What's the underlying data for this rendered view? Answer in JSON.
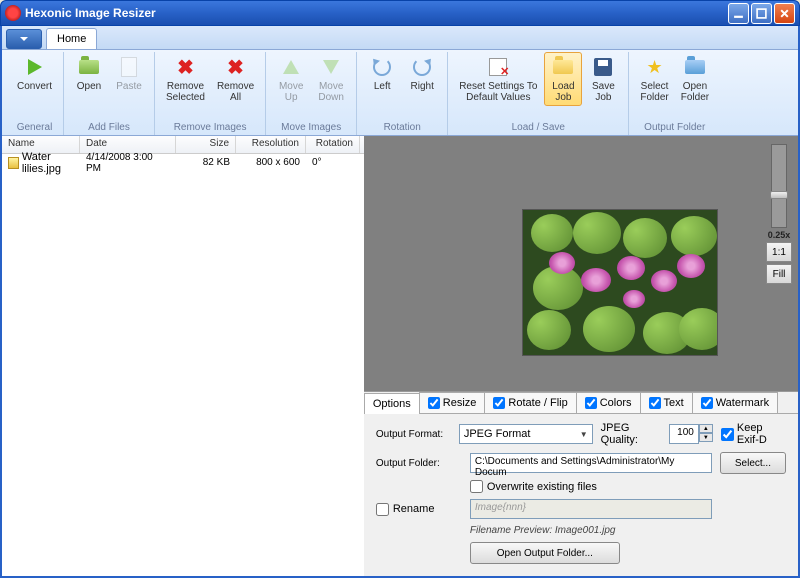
{
  "title": "Hexonic Image Resizer",
  "menubar": {
    "tab_home": "Home"
  },
  "ribbon": {
    "convert": "Convert",
    "open": "Open",
    "paste": "Paste",
    "remove_selected": "Remove\nSelected",
    "remove_all": "Remove\nAll",
    "move_up": "Move\nUp",
    "move_down": "Move\nDown",
    "left": "Left",
    "right": "Right",
    "reset": "Reset Settings To\nDefault Values",
    "load_job": "Load\nJob",
    "save_job": "Save\nJob",
    "select_folder": "Select\nFolder",
    "open_folder": "Open\nFolder",
    "groups": {
      "general": "General",
      "add_files": "Add Files",
      "remove_images": "Remove Images",
      "move_images": "Move Images",
      "rotation": "Rotation",
      "load_save": "Load / Save",
      "output_folder": "Output Folder"
    }
  },
  "list": {
    "cols": {
      "name": "Name",
      "date": "Date",
      "size": "Size",
      "resolution": "Resolution",
      "rotation": "Rotation"
    },
    "rows": [
      {
        "name": "Water lilies.jpg",
        "date": "4/14/2008 3:00 PM",
        "size": "82 KB",
        "resolution": "800 x 600",
        "rotation": "0°"
      }
    ]
  },
  "zoom": {
    "label": "0.25x",
    "btn_11": "1:1",
    "btn_fill": "Fill"
  },
  "tabs": {
    "options": "Options",
    "resize": "Resize",
    "rotate_flip": "Rotate / Flip",
    "colors": "Colors",
    "text": "Text",
    "watermark": "Watermark"
  },
  "options": {
    "output_format_label": "Output Format:",
    "output_format_value": "JPEG Format",
    "jpeg_quality_label": "JPEG Quality:",
    "jpeg_quality_value": "100",
    "keep_exif_label": "Keep Exif-D",
    "output_folder_label": "Output Folder:",
    "output_folder_value": "C:\\Documents and Settings\\Administrator\\My Docum",
    "select_btn": "Select...",
    "overwrite_label": "Overwrite existing files",
    "rename_label": "Rename",
    "rename_placeholder": "Image{nnn}",
    "filename_preview": "Filename Preview: Image001.jpg",
    "open_output_btn": "Open Output Folder..."
  }
}
